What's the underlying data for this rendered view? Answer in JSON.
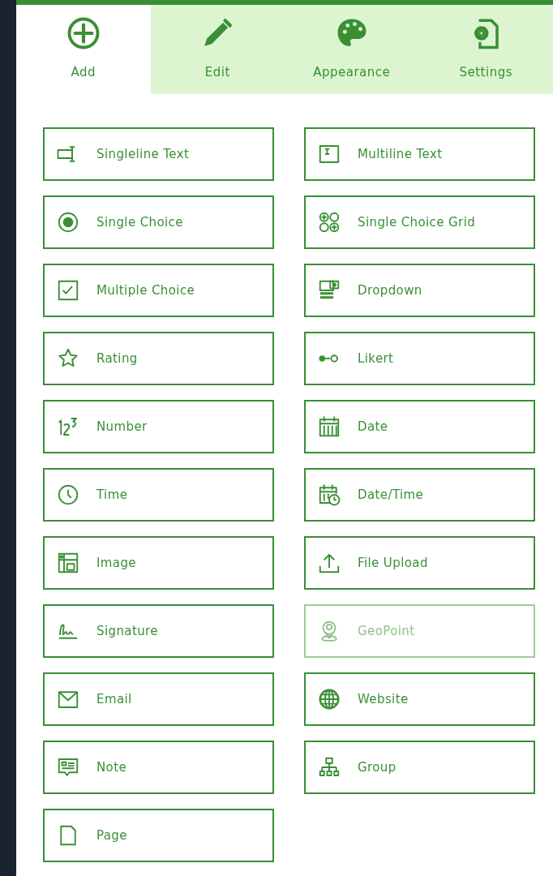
{
  "tabs": [
    {
      "label": "Add",
      "kind": "add",
      "selected": true
    },
    {
      "label": "Edit",
      "kind": "edit",
      "selected": false
    },
    {
      "label": "Appearance",
      "kind": "palette",
      "selected": false
    },
    {
      "label": "Settings",
      "kind": "settings",
      "selected": false
    }
  ],
  "fields": [
    {
      "label": "Singleline Text",
      "kind": "singleline",
      "disabled": false
    },
    {
      "label": "Multiline Text",
      "kind": "multiline",
      "disabled": false
    },
    {
      "label": "Single Choice",
      "kind": "radio",
      "disabled": false
    },
    {
      "label": "Single Choice Grid",
      "kind": "grid",
      "disabled": false
    },
    {
      "label": "Multiple Choice",
      "kind": "checkbox",
      "disabled": false
    },
    {
      "label": "Dropdown",
      "kind": "dropdown",
      "disabled": false
    },
    {
      "label": "Rating",
      "kind": "star",
      "disabled": false
    },
    {
      "label": "Likert",
      "kind": "likert",
      "disabled": false
    },
    {
      "label": "Number",
      "kind": "number",
      "disabled": false
    },
    {
      "label": "Date",
      "kind": "calendar",
      "disabled": false
    },
    {
      "label": "Time",
      "kind": "clock",
      "disabled": false
    },
    {
      "label": "Date/Time",
      "kind": "datetime",
      "disabled": false
    },
    {
      "label": "Image",
      "kind": "image",
      "disabled": false
    },
    {
      "label": "File Upload",
      "kind": "upload",
      "disabled": false
    },
    {
      "label": "Signature",
      "kind": "signature",
      "disabled": false
    },
    {
      "label": "GeoPoint",
      "kind": "pin",
      "disabled": true
    },
    {
      "label": "Email",
      "kind": "envelope",
      "disabled": false
    },
    {
      "label": "Website",
      "kind": "globe",
      "disabled": false
    },
    {
      "label": "Note",
      "kind": "note",
      "disabled": false
    },
    {
      "label": "Group",
      "kind": "hierarchy",
      "disabled": false
    },
    {
      "label": "Page",
      "kind": "page",
      "disabled": false
    }
  ]
}
